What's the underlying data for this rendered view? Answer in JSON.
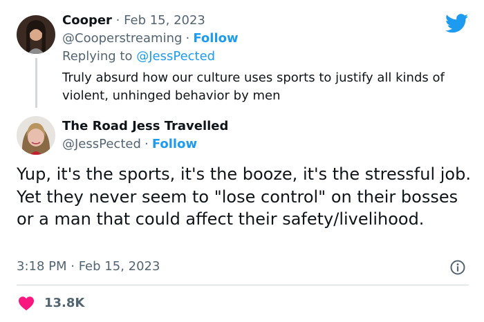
{
  "parent_tweet": {
    "author_name": "Cooper",
    "separator": "·",
    "date": "Feb 15, 2023",
    "handle": "@Cooperstreaming",
    "follow_label": "Follow",
    "replying_prefix": "Replying to",
    "replying_to": "@JessPected",
    "text": "Truly absurd how our culture uses sports to justify all kinds of violent, unhinged behavior by men"
  },
  "main_tweet": {
    "author_name": "The Road Jess Travelled",
    "handle": "@JessPected",
    "separator": "·",
    "follow_label": "Follow",
    "text": "Yup, it's the sports, it's the booze, it's the stressful job. Yet they never seem to \"lose control\" on their bosses or a man that could affect their safety/livelihood.",
    "time": "3:18 PM · Feb 15, 2023",
    "likes": "13.8K"
  },
  "icons": {
    "brand": "twitter-bird-icon",
    "info": "info-icon",
    "like": "heart-icon"
  },
  "colors": {
    "accent": "#1d9bf0",
    "like": "#f91880",
    "text": "#0f1419",
    "muted": "#536471"
  }
}
